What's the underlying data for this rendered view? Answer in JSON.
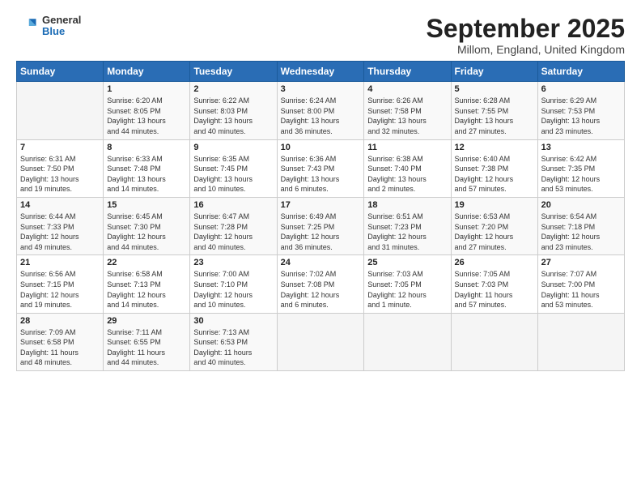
{
  "header": {
    "logo_general": "General",
    "logo_blue": "Blue",
    "month_title": "September 2025",
    "location": "Millom, England, United Kingdom"
  },
  "weekdays": [
    "Sunday",
    "Monday",
    "Tuesday",
    "Wednesday",
    "Thursday",
    "Friday",
    "Saturday"
  ],
  "weeks": [
    [
      {
        "num": "",
        "info": ""
      },
      {
        "num": "1",
        "info": "Sunrise: 6:20 AM\nSunset: 8:05 PM\nDaylight: 13 hours\nand 44 minutes."
      },
      {
        "num": "2",
        "info": "Sunrise: 6:22 AM\nSunset: 8:03 PM\nDaylight: 13 hours\nand 40 minutes."
      },
      {
        "num": "3",
        "info": "Sunrise: 6:24 AM\nSunset: 8:00 PM\nDaylight: 13 hours\nand 36 minutes."
      },
      {
        "num": "4",
        "info": "Sunrise: 6:26 AM\nSunset: 7:58 PM\nDaylight: 13 hours\nand 32 minutes."
      },
      {
        "num": "5",
        "info": "Sunrise: 6:28 AM\nSunset: 7:55 PM\nDaylight: 13 hours\nand 27 minutes."
      },
      {
        "num": "6",
        "info": "Sunrise: 6:29 AM\nSunset: 7:53 PM\nDaylight: 13 hours\nand 23 minutes."
      }
    ],
    [
      {
        "num": "7",
        "info": "Sunrise: 6:31 AM\nSunset: 7:50 PM\nDaylight: 13 hours\nand 19 minutes."
      },
      {
        "num": "8",
        "info": "Sunrise: 6:33 AM\nSunset: 7:48 PM\nDaylight: 13 hours\nand 14 minutes."
      },
      {
        "num": "9",
        "info": "Sunrise: 6:35 AM\nSunset: 7:45 PM\nDaylight: 13 hours\nand 10 minutes."
      },
      {
        "num": "10",
        "info": "Sunrise: 6:36 AM\nSunset: 7:43 PM\nDaylight: 13 hours\nand 6 minutes."
      },
      {
        "num": "11",
        "info": "Sunrise: 6:38 AM\nSunset: 7:40 PM\nDaylight: 13 hours\nand 2 minutes."
      },
      {
        "num": "12",
        "info": "Sunrise: 6:40 AM\nSunset: 7:38 PM\nDaylight: 12 hours\nand 57 minutes."
      },
      {
        "num": "13",
        "info": "Sunrise: 6:42 AM\nSunset: 7:35 PM\nDaylight: 12 hours\nand 53 minutes."
      }
    ],
    [
      {
        "num": "14",
        "info": "Sunrise: 6:44 AM\nSunset: 7:33 PM\nDaylight: 12 hours\nand 49 minutes."
      },
      {
        "num": "15",
        "info": "Sunrise: 6:45 AM\nSunset: 7:30 PM\nDaylight: 12 hours\nand 44 minutes."
      },
      {
        "num": "16",
        "info": "Sunrise: 6:47 AM\nSunset: 7:28 PM\nDaylight: 12 hours\nand 40 minutes."
      },
      {
        "num": "17",
        "info": "Sunrise: 6:49 AM\nSunset: 7:25 PM\nDaylight: 12 hours\nand 36 minutes."
      },
      {
        "num": "18",
        "info": "Sunrise: 6:51 AM\nSunset: 7:23 PM\nDaylight: 12 hours\nand 31 minutes."
      },
      {
        "num": "19",
        "info": "Sunrise: 6:53 AM\nSunset: 7:20 PM\nDaylight: 12 hours\nand 27 minutes."
      },
      {
        "num": "20",
        "info": "Sunrise: 6:54 AM\nSunset: 7:18 PM\nDaylight: 12 hours\nand 23 minutes."
      }
    ],
    [
      {
        "num": "21",
        "info": "Sunrise: 6:56 AM\nSunset: 7:15 PM\nDaylight: 12 hours\nand 19 minutes."
      },
      {
        "num": "22",
        "info": "Sunrise: 6:58 AM\nSunset: 7:13 PM\nDaylight: 12 hours\nand 14 minutes."
      },
      {
        "num": "23",
        "info": "Sunrise: 7:00 AM\nSunset: 7:10 PM\nDaylight: 12 hours\nand 10 minutes."
      },
      {
        "num": "24",
        "info": "Sunrise: 7:02 AM\nSunset: 7:08 PM\nDaylight: 12 hours\nand 6 minutes."
      },
      {
        "num": "25",
        "info": "Sunrise: 7:03 AM\nSunset: 7:05 PM\nDaylight: 12 hours\nand 1 minute."
      },
      {
        "num": "26",
        "info": "Sunrise: 7:05 AM\nSunset: 7:03 PM\nDaylight: 11 hours\nand 57 minutes."
      },
      {
        "num": "27",
        "info": "Sunrise: 7:07 AM\nSunset: 7:00 PM\nDaylight: 11 hours\nand 53 minutes."
      }
    ],
    [
      {
        "num": "28",
        "info": "Sunrise: 7:09 AM\nSunset: 6:58 PM\nDaylight: 11 hours\nand 48 minutes."
      },
      {
        "num": "29",
        "info": "Sunrise: 7:11 AM\nSunset: 6:55 PM\nDaylight: 11 hours\nand 44 minutes."
      },
      {
        "num": "30",
        "info": "Sunrise: 7:13 AM\nSunset: 6:53 PM\nDaylight: 11 hours\nand 40 minutes."
      },
      {
        "num": "",
        "info": ""
      },
      {
        "num": "",
        "info": ""
      },
      {
        "num": "",
        "info": ""
      },
      {
        "num": "",
        "info": ""
      }
    ]
  ]
}
